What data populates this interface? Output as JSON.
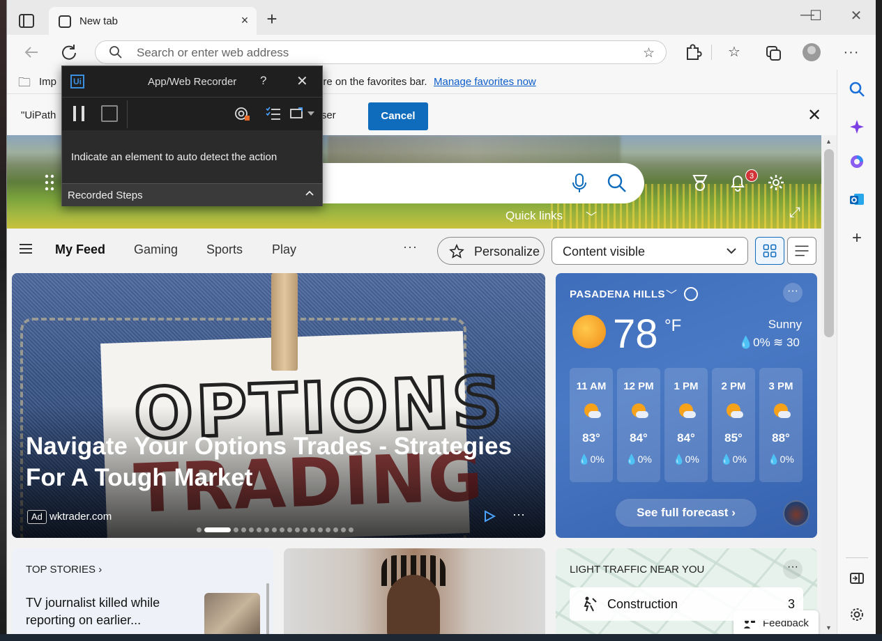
{
  "browser": {
    "tab": {
      "title": "New tab",
      "close": "×"
    },
    "new_tab": "+",
    "window": {
      "minimize": "—",
      "maximize": "☐",
      "close": "✕"
    },
    "address": {
      "placeholder": "Search or enter web address"
    }
  },
  "favorites_bar": {
    "text_left": "Imp",
    "text_right": "ere on the favorites bar.",
    "link": "Manage favorites now"
  },
  "infobar": {
    "text_left": "\"UiPath",
    "text_right": "wser",
    "cancel_label": "Cancel"
  },
  "recorder": {
    "logo": "Ui",
    "title": "App/Web Recorder",
    "help": "?",
    "close": "✕",
    "hint": "Indicate an element to auto detect the action",
    "steps_label": "Recorded Steps"
  },
  "hero": {
    "notifications_count": "3",
    "quick_links": "Quick links"
  },
  "feed_nav": {
    "tabs": [
      "My Feed",
      "Gaming",
      "Sports",
      "Play"
    ],
    "more": "···",
    "personalize": "Personalize",
    "content_select": "Content visible"
  },
  "ad": {
    "title": "Navigate Your Options Trades - Strategies For A Tough Market",
    "badge": "Ad",
    "source": "wktrader.com",
    "more": "···",
    "carousel_total": 18,
    "carousel_active": 2
  },
  "weather": {
    "location": "PASADENA HILLS",
    "temp": "78",
    "unit": "°F",
    "condition": "Sunny",
    "precip": "💧0%",
    "wind": "≋ 30",
    "more": "···",
    "hourly": [
      {
        "time": "11 AM",
        "temp": "83°",
        "precip": "💧0%"
      },
      {
        "time": "12 PM",
        "temp": "84°",
        "precip": "💧0%"
      },
      {
        "time": "1 PM",
        "temp": "84°",
        "precip": "💧0%"
      },
      {
        "time": "2 PM",
        "temp": "85°",
        "precip": "💧0%"
      },
      {
        "time": "3 PM",
        "temp": "88°",
        "precip": "💧0%"
      }
    ],
    "forecast_button": "See full forecast ›"
  },
  "top_stories": {
    "heading": "TOP STORIES ›",
    "item": "TV journalist killed while reporting on earlier..."
  },
  "traffic": {
    "heading": "LIGHT TRAFFIC NEAR YOU",
    "more": "···",
    "row_label": "Construction",
    "row_count": "3"
  },
  "feedback": {
    "label": "Feedback"
  },
  "colors": {
    "accent": "#0f6cbd",
    "weather_bg": "#4a79c4",
    "notification": "#d13438",
    "recorder_bg": "#2b2b2b"
  },
  "icons": [
    "tab-actions-icon",
    "back-icon",
    "refresh-icon",
    "search-icon",
    "favorite-add-icon",
    "extensions-icon",
    "favorites-icon",
    "collections-icon",
    "profile-icon",
    "settings-more-icon",
    "bing-search-icon",
    "copilot-icon",
    "office-icon",
    "outlook-icon",
    "add-icon",
    "sidebar-toggle-icon",
    "gear-icon"
  ]
}
